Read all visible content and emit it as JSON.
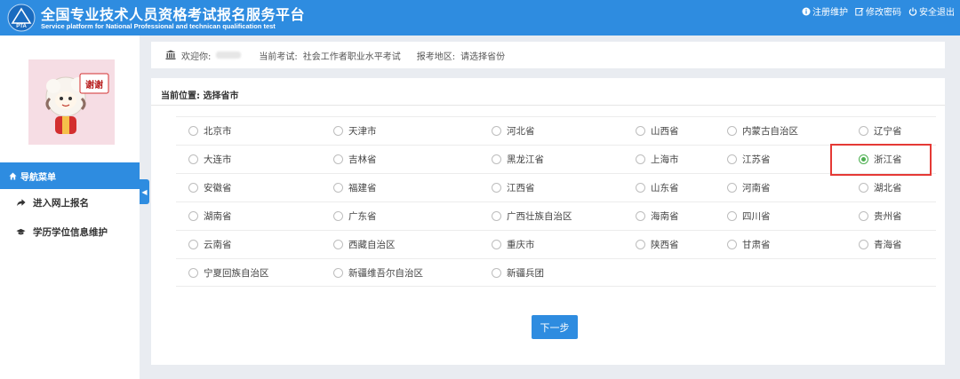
{
  "header": {
    "title_cn": "全国专业技术人员资格考试报名服务平台",
    "title_en": "Service platform for National Professional and technican qualification test",
    "logo_text": "PTA",
    "actions": [
      {
        "label": "注册维护",
        "icon": "info-icon"
      },
      {
        "label": "修改密码",
        "icon": "edit-icon"
      },
      {
        "label": "安全退出",
        "icon": "power-icon"
      }
    ]
  },
  "sidebar": {
    "avatar_text": "谢谢",
    "nav_header": "导航菜单",
    "items": [
      {
        "label": "进入网上报名",
        "icon": "share-arrow-icon"
      },
      {
        "label": "学历学位信息维护",
        "icon": "graduation-cap-icon"
      }
    ]
  },
  "infobar": {
    "welcome_label": "欢迎你:",
    "exam_label": "当前考试:",
    "exam_value": "社会工作者职业水平考试",
    "region_label": "报考地区:",
    "region_value": "请选择省份"
  },
  "panel": {
    "location_label": "当前位置: 选择省市",
    "selected": "浙江省",
    "rows": [
      [
        "北京市",
        "天津市",
        "河北省",
        "山西省",
        "内蒙古自治区",
        "辽宁省"
      ],
      [
        "大连市",
        "吉林省",
        "黑龙江省",
        "上海市",
        "江苏省",
        "浙江省"
      ],
      [
        "安徽省",
        "福建省",
        "江西省",
        "山东省",
        "河南省",
        "湖北省"
      ],
      [
        "湖南省",
        "广东省",
        "广西壮族自治区",
        "海南省",
        "四川省",
        "贵州省"
      ],
      [
        "云南省",
        "西藏自治区",
        "重庆市",
        "陕西省",
        "甘肃省",
        "青海省"
      ],
      [
        "宁夏回族自治区",
        "新疆维吾尔自治区",
        "新疆兵团"
      ]
    ],
    "next_label": "下一步"
  },
  "colors": {
    "primary": "#2e8ce0",
    "selected_radio": "#4caf50",
    "highlight": "#e53935"
  }
}
